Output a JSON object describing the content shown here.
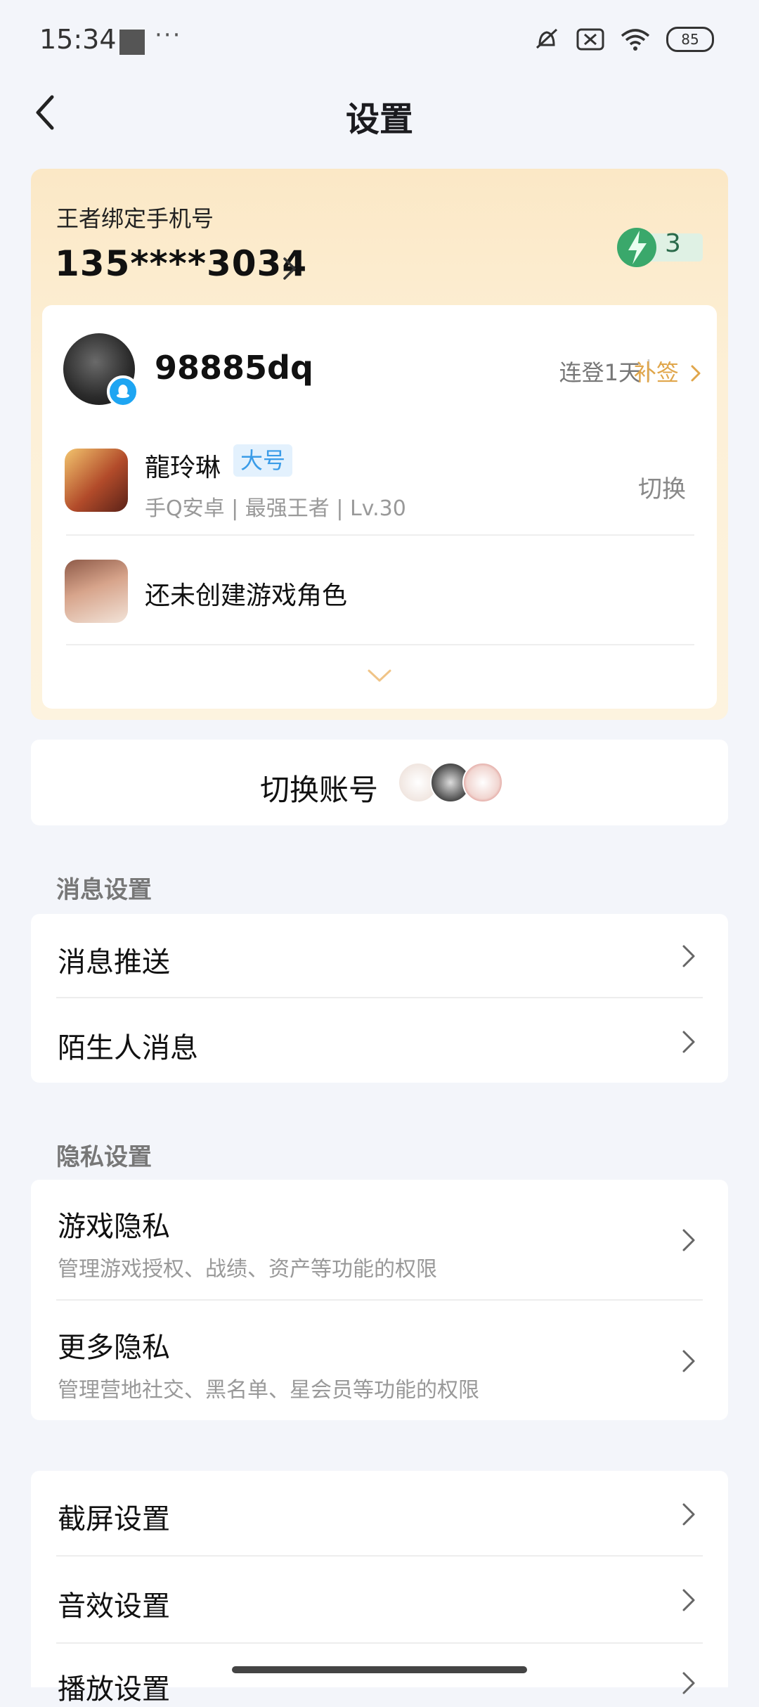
{
  "status_bar": {
    "time": "15:34",
    "dots": "···",
    "battery": "85"
  },
  "header": {
    "title": "设置"
  },
  "account": {
    "bind_label": "王者绑定手机号",
    "phone": "135****3034",
    "energy_count": "3",
    "username": "98885dq",
    "streak": "连登1天",
    "makeup": "补签",
    "roles": [
      {
        "name": "龍玲琳",
        "tag": "大号",
        "meta": "手Q安卓 | 最强王者 | Lv.30",
        "action": "切换"
      },
      {
        "name": "还未创建游戏角色"
      }
    ]
  },
  "switch_account": {
    "label": "切换账号"
  },
  "sections": {
    "message": {
      "title": "消息设置",
      "items": [
        {
          "label": "消息推送"
        },
        {
          "label": "陌生人消息"
        }
      ]
    },
    "privacy": {
      "title": "隐私设置",
      "items": [
        {
          "label": "游戏隐私",
          "sub": "管理游戏授权、战绩、资产等功能的权限"
        },
        {
          "label": "更多隐私",
          "sub": "管理营地社交、黑名单、星会员等功能的权限"
        }
      ]
    },
    "other": {
      "items": [
        {
          "label": "截屏设置"
        },
        {
          "label": "音效设置"
        },
        {
          "label": "播放设置"
        }
      ]
    }
  },
  "colors": {
    "accent": "#e0a64b",
    "tag_blue": "#3a9ce8",
    "energy_green": "#3aa86b"
  },
  "icons": [
    "back-icon",
    "chevron-right-icon",
    "expand-chevron-icon",
    "qq-icon",
    "energy-icon",
    "mute-icon",
    "sim-off-icon",
    "wifi-icon",
    "battery-icon"
  ]
}
